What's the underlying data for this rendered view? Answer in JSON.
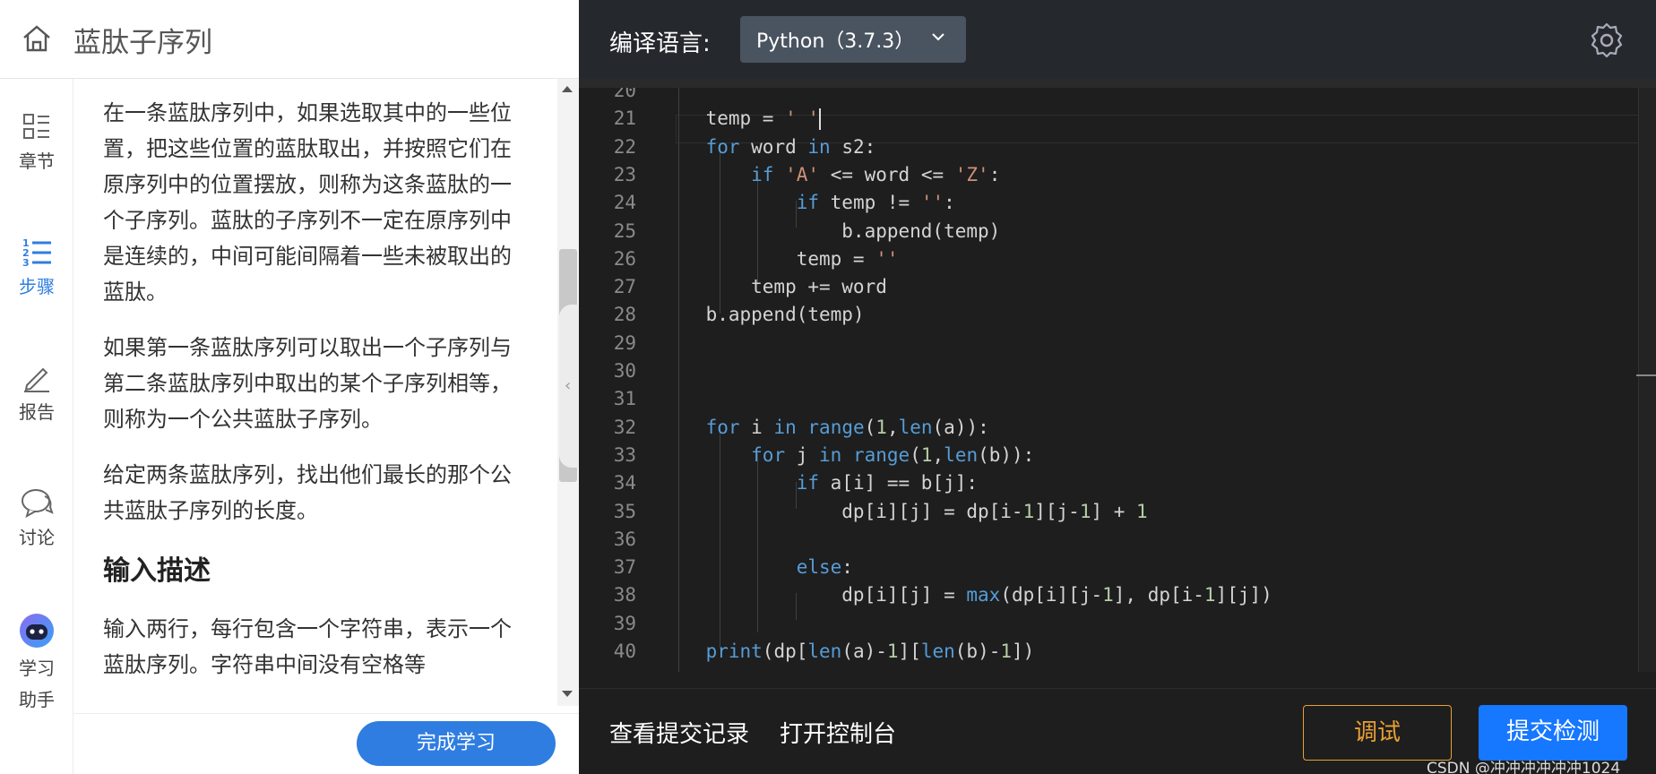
{
  "left": {
    "title": "蓝肽子序列",
    "rail": [
      {
        "label": "章节",
        "icon": "chapter-icon"
      },
      {
        "label": "步骤",
        "icon": "steps-icon"
      },
      {
        "label": "报告",
        "icon": "pencil-icon"
      },
      {
        "label": "讨论",
        "icon": "chat-icon"
      },
      {
        "label": "学习",
        "label2": "助手",
        "icon": "robot-icon"
      }
    ],
    "paragraphs": [
      "在一条蓝肽序列中，如果选取其中的一些位置，把这些位置的蓝肽取出，并按照它们在原序列中的位置摆放，则称为这条蓝肽的一个子序列。蓝肽的子序列不一定在原序列中是连续的，中间可能间隔着一些未被取出的蓝肽。",
      "如果第一条蓝肽序列可以取出一个子序列与第二条蓝肽序列中取出的某个子序列相等，则称为一个公共蓝肽子序列。",
      "给定两条蓝肽序列，找出他们最长的那个公共蓝肽子序列的长度。"
    ],
    "section_heading": "输入描述",
    "input_paragraph": "输入两行，每行包含一个字符串，表示一个蓝肽序列。字符串中间没有空格等",
    "finish_button": "完成学习"
  },
  "right": {
    "lang_label": "编译语言:",
    "lang_value": "Python（3.7.3）",
    "history_link": "查看提交记录",
    "console_link": "打开控制台",
    "debug_button": "调试",
    "submit_button": "提交检测",
    "watermark": "CSDN @冲冲冲冲冲冲1024"
  },
  "code_lines": [
    {
      "n": "20",
      "c": ""
    },
    {
      "n": "21",
      "c": "    temp = ' '"
    },
    {
      "n": "22",
      "c": "    for word in s2:"
    },
    {
      "n": "23",
      "c": "        if 'A' <= word <= 'Z':"
    },
    {
      "n": "24",
      "c": "            if temp != '':"
    },
    {
      "n": "25",
      "c": "                b.append(temp)"
    },
    {
      "n": "26",
      "c": "            temp = ''"
    },
    {
      "n": "27",
      "c": "        temp += word"
    },
    {
      "n": "28",
      "c": "    b.append(temp)"
    },
    {
      "n": "29",
      "c": ""
    },
    {
      "n": "30",
      "c": ""
    },
    {
      "n": "31",
      "c": ""
    },
    {
      "n": "32",
      "c": "    for i in range(1,len(a)):"
    },
    {
      "n": "33",
      "c": "        for j in range(1,len(b)):"
    },
    {
      "n": "34",
      "c": "            if a[i] == b[j]:"
    },
    {
      "n": "35",
      "c": "                dp[i][j] = dp[i-1][j-1] + 1"
    },
    {
      "n": "36",
      "c": ""
    },
    {
      "n": "37",
      "c": "            else:"
    },
    {
      "n": "38",
      "c": "                dp[i][j] = max(dp[i][j-1], dp[i-1][j])"
    },
    {
      "n": "39",
      "c": ""
    },
    {
      "n": "40",
      "c": "    print(dp[len(a)-1][len(b)-1])"
    }
  ],
  "colors": {
    "accent": "#2f7de1",
    "submit": "#1677ff",
    "debug": "#e8a035",
    "keyword": "#569cd6",
    "string": "#ce9178",
    "number": "#b5cea8"
  }
}
